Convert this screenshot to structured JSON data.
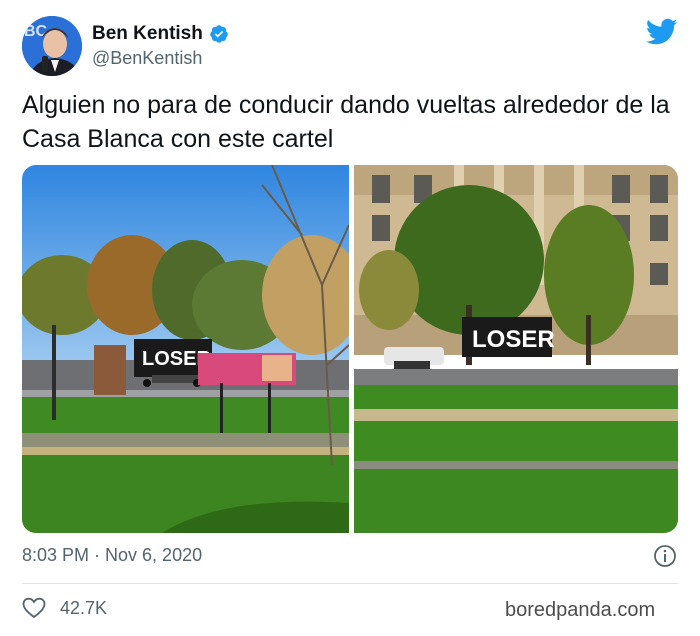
{
  "author": {
    "name": "Ben Kentish",
    "handle": "@BenKentish",
    "verified": true,
    "avatar": "profile-photo"
  },
  "tweet": {
    "text": "Alguien no para de conducir dando vueltas alrededor de la Casa Blanca con este cartel",
    "timestamp": "8:03 PM · Nov 6, 2020",
    "likes": "42.7K"
  },
  "media": [
    {
      "description": "truck-sign-lawn-trees",
      "sign_text": "LOSER"
    },
    {
      "description": "truck-sign-in-front-of-building",
      "sign_text": "LOSER"
    }
  ],
  "watermark": "boredpanda.com",
  "colors": {
    "twitter_blue": "#1d9bf0",
    "secondary_text": "#536471",
    "divider": "#e1e4e6"
  }
}
